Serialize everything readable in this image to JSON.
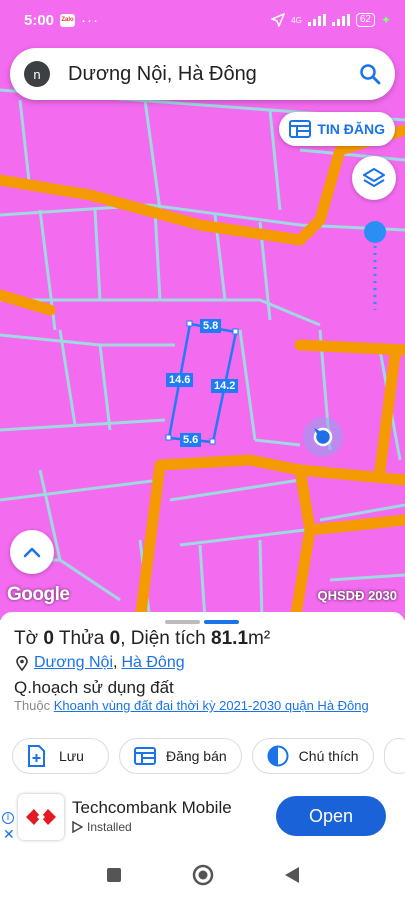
{
  "status_bar": {
    "time": "5:00",
    "zalo": "Zalo",
    "dots": "···",
    "network": "4G",
    "battery": "62"
  },
  "search": {
    "avatar_letter": "n",
    "query": "Dương Nội, Hà Đông",
    "icon": "search-icon"
  },
  "map": {
    "tin_dang_label": "TIN ĐĂNG",
    "layers_icon": "layers-icon",
    "parcel_dims": {
      "top": "5.8",
      "left": "14.6",
      "right": "14.2",
      "bottom": "5.6"
    },
    "google": "Google",
    "layer_name": "QHSDĐ 2030",
    "colors": {
      "land": "#f36bef",
      "road": "#f59a00",
      "parcel": "#1e7cf5",
      "boundary": "#9fd8e0"
    }
  },
  "sheet": {
    "title_to_label": "Tờ",
    "title_to_value": "0",
    "title_thua_label": "Thửa",
    "title_thua_value": "0",
    "title_area_label": "Diện tích",
    "title_area_value": "81.1",
    "title_area_unit": "m²",
    "location_1": "Dương Nội",
    "location_sep": ",",
    "location_2": "Hà Đông",
    "qh_title": "Q.hoạch sử dụng đất",
    "thuoc_label": "Thuộc",
    "thuoc_link": "Khoanh vùng đất đai thời kỳ 2021-2030 quận Hà Đông",
    "actions": [
      {
        "label": "Lưu",
        "icon": "add-file-icon"
      },
      {
        "label": "Đăng bán",
        "icon": "listing-icon"
      },
      {
        "label": "Chú thích",
        "icon": "contrast-icon"
      }
    ]
  },
  "ad": {
    "name": "Techcombank Mobile",
    "status": "Installed",
    "open_label": "Open",
    "info": "i",
    "close": "✕"
  }
}
